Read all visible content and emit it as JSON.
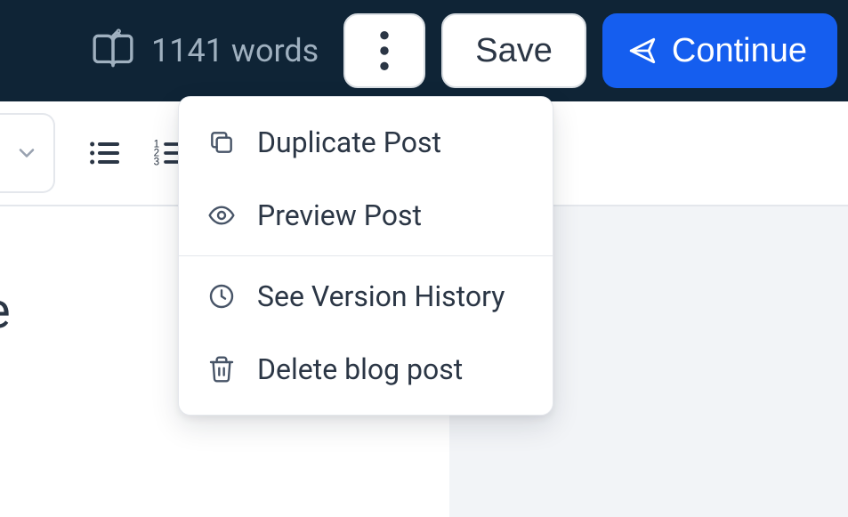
{
  "topbar": {
    "word_count_text": "1141 words",
    "save_label": "Save",
    "continue_label": "Continue"
  },
  "menu": {
    "duplicate_label": "Duplicate Post",
    "preview_label": "Preview Post",
    "history_label": "See Version History",
    "delete_label": "Delete blog post"
  },
  "content": {
    "partial_glyph": "e"
  }
}
